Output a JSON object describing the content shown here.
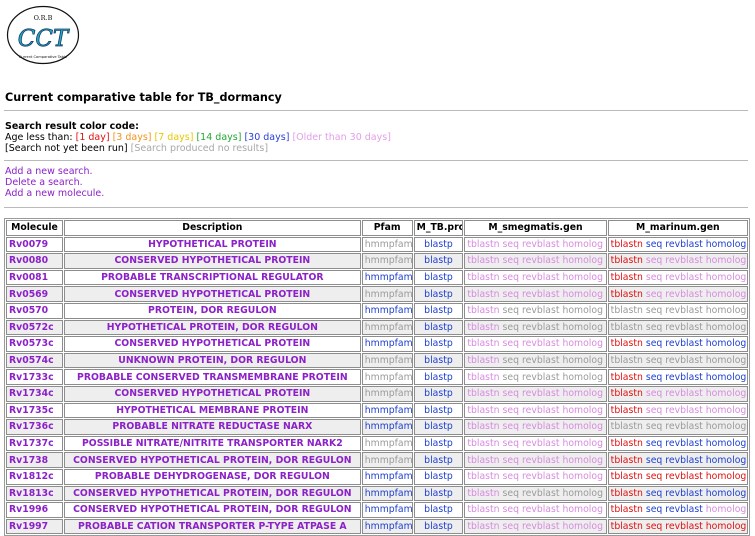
{
  "logo": {
    "top_text": "O.R.B",
    "main_text": "CCT",
    "bottom_text": "Current Comparative Table"
  },
  "page_title": "Current comparative table for TB_dormancy",
  "legend": {
    "heading": "Search result color code:",
    "age_prefix": "Age less than: ",
    "items": [
      {
        "text": "[1 day]",
        "color": "#e01010"
      },
      {
        "text": "[3 days]",
        "color": "#f0921e"
      },
      {
        "text": "[7 days]",
        "color": "#e8c800"
      },
      {
        "text": "[14 days]",
        "color": "#22a832"
      },
      {
        "text": "[30 days]",
        "color": "#2a3fd6"
      },
      {
        "text": "[Older than 30 days]",
        "color": "#e29ee8"
      }
    ],
    "not_run": "[Search not yet been run]",
    "no_results": "[Search produced no results]"
  },
  "actions": [
    "Add a new search.",
    "Delete a search.",
    "Add a new molecule."
  ],
  "table": {
    "headers": [
      "Molecule",
      "Description",
      "Pfam",
      "M_TB.prot",
      "M_smegmatis.gen",
      "M_marinum.gen"
    ],
    "rows": [
      {
        "molecule": "Rv0079",
        "description": "HYPOTHETICAL PROTEIN",
        "pfam": "hmmpfam",
        "pfam_color": "grey",
        "tb": "blastp",
        "smeg": [
          "pink",
          "pink",
          "pink",
          "pink"
        ],
        "mar": [
          "red",
          "blue",
          "blue",
          "blue"
        ]
      },
      {
        "molecule": "Rv0080",
        "description": "CONSERVED HYPOTHETICAL PROTEIN",
        "pfam": "hmmpfam",
        "pfam_color": "grey",
        "tb": "blastp",
        "smeg": [
          "pink",
          "pink",
          "pink",
          "pink"
        ],
        "mar": [
          "red",
          "pink",
          "pink",
          "pink"
        ]
      },
      {
        "molecule": "Rv0081",
        "description": "PROBABLE TRANSCRIPTIONAL REGULATOR",
        "pfam": "hmmpfam",
        "pfam_color": "blue",
        "tb": "blastp",
        "smeg": [
          "pink",
          "pink",
          "pink",
          "pink"
        ],
        "mar": [
          "red",
          "pink",
          "pink",
          "pink"
        ]
      },
      {
        "molecule": "Rv0569",
        "description": "CONSERVED HYPOTHETICAL PROTEIN",
        "pfam": "hmmpfam",
        "pfam_color": "grey",
        "tb": "blastp",
        "smeg": [
          "pink",
          "pink",
          "pink",
          "pink"
        ],
        "mar": [
          "red",
          "pink",
          "pink",
          "pink"
        ]
      },
      {
        "molecule": "Rv0570",
        "description": "PROTEIN, DOR REGULON",
        "pfam": "hmmpfam",
        "pfam_color": "blue",
        "tb": "blastp",
        "smeg": [
          "pink",
          "grey",
          "grey",
          "grey"
        ],
        "mar": [
          "grey",
          "grey",
          "grey",
          "grey"
        ]
      },
      {
        "molecule": "Rv0572c",
        "description": "HYPOTHETICAL PROTEIN, DOR REGULON",
        "pfam": "hmmpfam",
        "pfam_color": "grey",
        "tb": "blastp",
        "smeg": [
          "pink",
          "grey",
          "grey",
          "grey"
        ],
        "mar": [
          "grey",
          "grey",
          "grey",
          "grey"
        ]
      },
      {
        "molecule": "Rv0573c",
        "description": "CONSERVED HYPOTHETICAL PROTEIN",
        "pfam": "hmmpfam",
        "pfam_color": "blue",
        "tb": "blastp",
        "smeg": [
          "pink",
          "pink",
          "pink",
          "pink"
        ],
        "mar": [
          "red",
          "blue",
          "blue",
          "blue"
        ]
      },
      {
        "molecule": "Rv0574c",
        "description": "UNKNOWN PROTEIN, DOR REGULON",
        "pfam": "hmmpfam",
        "pfam_color": "grey",
        "tb": "blastp",
        "smeg": [
          "pink",
          "grey",
          "grey",
          "grey"
        ],
        "mar": [
          "grey",
          "grey",
          "grey",
          "grey"
        ]
      },
      {
        "molecule": "Rv1733c",
        "description": "PROBABLE CONSERVED TRANSMEMBRANE PROTEIN",
        "pfam": "hmmpfam",
        "pfam_color": "grey",
        "tb": "blastp",
        "smeg": [
          "pink",
          "grey",
          "grey",
          "grey"
        ],
        "mar": [
          "red",
          "blue",
          "blue",
          "blue"
        ]
      },
      {
        "molecule": "Rv1734c",
        "description": "CONSERVED HYPOTHETICAL PROTEIN",
        "pfam": "hmmpfam",
        "pfam_color": "grey",
        "tb": "blastp",
        "smeg": [
          "pink",
          "pink",
          "pink",
          "pink"
        ],
        "mar": [
          "red",
          "pink",
          "pink",
          "pink"
        ]
      },
      {
        "molecule": "Rv1735c",
        "description": "HYPOTHETICAL MEMBRANE PROTEIN",
        "pfam": "hmmpfam",
        "pfam_color": "blue",
        "tb": "blastp",
        "smeg": [
          "pink",
          "pink",
          "pink",
          "pink"
        ],
        "mar": [
          "red",
          "pink",
          "pink",
          "pink"
        ]
      },
      {
        "molecule": "Rv1736c",
        "description": "PROBABLE NITRATE REDUCTASE NARX",
        "pfam": "hmmpfam",
        "pfam_color": "blue",
        "tb": "blastp",
        "smeg": [
          "pink",
          "pink",
          "pink",
          "pink"
        ],
        "mar": [
          "grey",
          "grey",
          "grey",
          "grey"
        ]
      },
      {
        "molecule": "Rv1737c",
        "description": "POSSIBLE NITRATE/NITRITE TRANSPORTER NARK2",
        "pfam": "hmmpfam",
        "pfam_color": "grey",
        "tb": "blastp",
        "smeg": [
          "pink",
          "pink",
          "pink",
          "pink"
        ],
        "mar": [
          "red",
          "blue",
          "blue",
          "blue"
        ]
      },
      {
        "molecule": "Rv1738",
        "description": "CONSERVED HYPOTHETICAL PROTEIN, DOR REGULON",
        "pfam": "hmmpfam",
        "pfam_color": "grey",
        "tb": "blastp",
        "smeg": [
          "pink",
          "pink",
          "pink",
          "pink"
        ],
        "mar": [
          "red",
          "blue",
          "blue",
          "blue"
        ]
      },
      {
        "molecule": "Rv1812c",
        "description": "PROBABLE DEHYDROGENASE, DOR REGULON",
        "pfam": "hmmpfam",
        "pfam_color": "blue",
        "tb": "blastp",
        "smeg": [
          "pink",
          "pink",
          "pink",
          "pink"
        ],
        "mar": [
          "red",
          "red",
          "red",
          "red"
        ]
      },
      {
        "molecule": "Rv1813c",
        "description": "CONSERVED HYPOTHETICAL PROTEIN, DOR REGULON",
        "pfam": "hmmpfam",
        "pfam_color": "blue",
        "tb": "blastp",
        "smeg": [
          "pink",
          "grey",
          "grey",
          "grey"
        ],
        "mar": [
          "red",
          "blue",
          "blue",
          "blue"
        ]
      },
      {
        "molecule": "Rv1996",
        "description": "CONSERVED HYPOTHETICAL PROTEIN, DOR REGULON",
        "pfam": "hmmpfam",
        "pfam_color": "blue",
        "tb": "blastp",
        "smeg": [
          "pink",
          "pink",
          "pink",
          "pink"
        ],
        "mar": [
          "red",
          "blue",
          "blue",
          "pink"
        ]
      },
      {
        "molecule": "Rv1997",
        "description": "PROBABLE CATION TRANSPORTER P-TYPE ATPASE A",
        "pfam": "hmmpfam",
        "pfam_color": "blue",
        "tb": "blastp",
        "smeg": [
          "pink",
          "pink",
          "pink",
          "pink"
        ],
        "mar": [
          "red",
          "red",
          "red",
          "red"
        ]
      }
    ],
    "search_links": [
      "tblastn",
      "seq",
      "revblast",
      "homolog"
    ]
  },
  "colors": {
    "blue": "#1d3fd0",
    "grey": "#9a9a9a",
    "red": "#e01010",
    "pink": "#d88ae0",
    "purple": "#8c21c8"
  }
}
